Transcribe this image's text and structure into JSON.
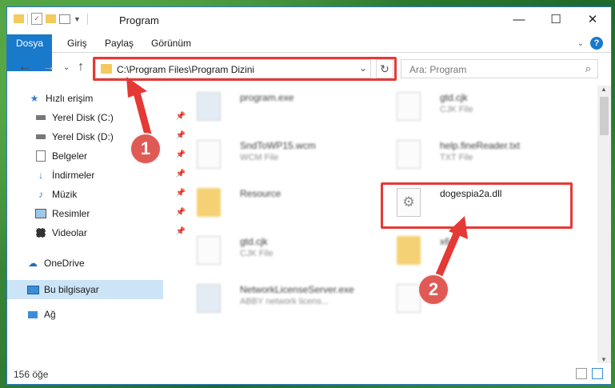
{
  "window": {
    "title": "Program"
  },
  "ribbon": {
    "tabs": [
      "Dosya",
      "Giriş",
      "Paylaş",
      "Görünüm"
    ],
    "help": "?"
  },
  "nav": {
    "back": "←",
    "forward": "→",
    "up": "↑",
    "chevron": "⌄"
  },
  "address": {
    "path": "C:\\Program Files\\Program Dizini",
    "refresh": "↻"
  },
  "search": {
    "placeholder": "Ara: Program"
  },
  "sidebar": {
    "items": [
      {
        "label": "Hızlı erişim",
        "icon": "star-icon"
      },
      {
        "label": "Yerel Disk (C:)",
        "icon": "drive-icon",
        "pinned": true
      },
      {
        "label": "Yerel Disk (D:)",
        "icon": "drive-icon",
        "pinned": true
      },
      {
        "label": "Belgeler",
        "icon": "documents-icon",
        "pinned": true
      },
      {
        "label": "İndirmeler",
        "icon": "download-icon",
        "pinned": true
      },
      {
        "label": "Müzik",
        "icon": "music-icon",
        "pinned": true
      },
      {
        "label": "Resimler",
        "icon": "pictures-icon",
        "pinned": true
      },
      {
        "label": "Videolar",
        "icon": "video-icon",
        "pinned": true
      },
      {
        "label": "OneDrive",
        "icon": "cloud-icon"
      },
      {
        "label": "Bu bilgisayar",
        "icon": "computer-icon",
        "selected": true
      },
      {
        "label": "Ağ",
        "icon": "network-icon"
      }
    ]
  },
  "files": [
    {
      "name": "program.exe",
      "type": ""
    },
    {
      "name": "gtd.cjk",
      "type": "CJK File"
    },
    {
      "name": "SndToWP15.wcm",
      "type": "WCM File"
    },
    {
      "name": "help.fineReader.txt",
      "type": "TXT File"
    },
    {
      "name": "Resource",
      "type": ""
    },
    {
      "name": "dogespia2a.dll",
      "type": ""
    },
    {
      "name": "gtd.cjk",
      "type": "CJK File"
    },
    {
      "name": "x64",
      "type": ""
    },
    {
      "name": "NetworkLicenseServer.exe",
      "type": "ABBY network licens..."
    }
  ],
  "status": {
    "count": "156 öğe"
  },
  "annotations": {
    "badge1": "1",
    "badge2": "2",
    "color": "#e53935"
  }
}
